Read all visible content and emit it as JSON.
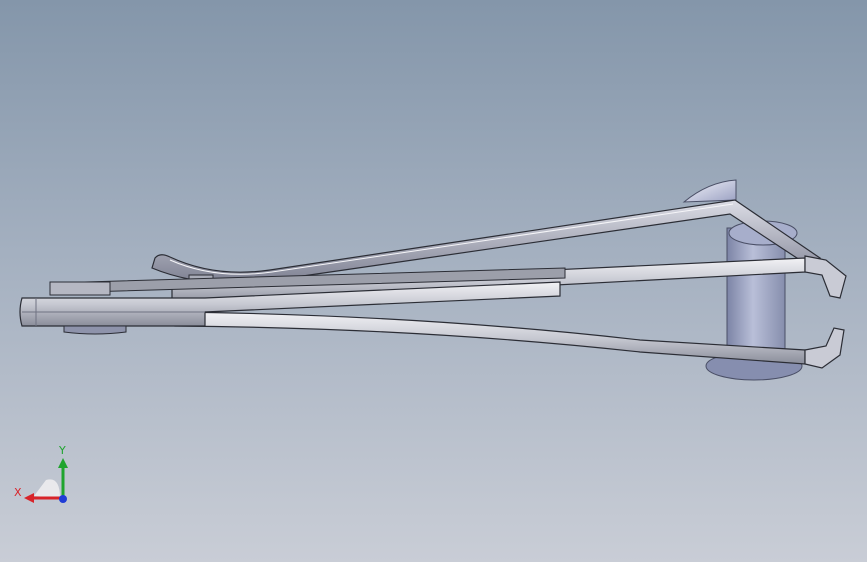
{
  "view": {
    "background_top": "#8496aa",
    "background_bottom": "#c9cdd6"
  },
  "model": {
    "part_colors": {
      "steel_light": "#e6e6ea",
      "steel_mid": "#b8bac4",
      "steel_dark": "#6f7282",
      "outline": "#2b2d35",
      "cylinder": "#9ea6c4",
      "cylinder_dark": "#7b84a5"
    }
  },
  "triad": {
    "x_label": "X",
    "y_label": "Y",
    "x_color": "#d8242a",
    "y_color": "#1fa42e",
    "z_color": "#1f3cd6"
  }
}
